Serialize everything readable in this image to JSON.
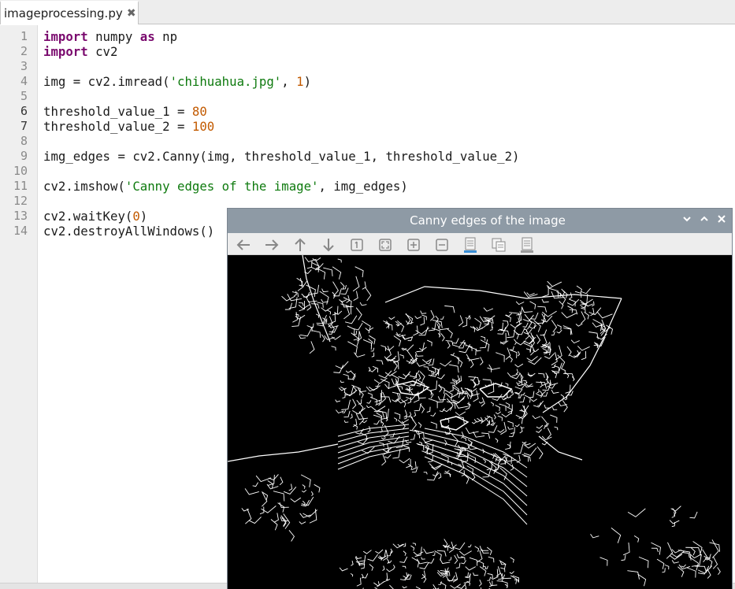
{
  "tab": {
    "filename": "imageprocessing.py",
    "close_glyph": "✖"
  },
  "editor": {
    "line_numbers": [
      "1",
      "2",
      "3",
      "4",
      "5",
      "6",
      "7",
      "8",
      "9",
      "10",
      "11",
      "12",
      "13",
      "14"
    ],
    "lines": [
      [
        {
          "t": "import",
          "c": "kw"
        },
        {
          "t": " numpy ",
          "c": ""
        },
        {
          "t": "as",
          "c": "kw"
        },
        {
          "t": " np",
          "c": ""
        }
      ],
      [
        {
          "t": "import",
          "c": "kw"
        },
        {
          "t": " cv2",
          "c": ""
        }
      ],
      [],
      [
        {
          "t": "img = cv2.imread(",
          "c": ""
        },
        {
          "t": "'chihuahua.jpg'",
          "c": "str"
        },
        {
          "t": ", ",
          "c": ""
        },
        {
          "t": "1",
          "c": "num"
        },
        {
          "t": ")",
          "c": ""
        }
      ],
      [],
      [
        {
          "t": "threshold_value_1 = ",
          "c": ""
        },
        {
          "t": "80",
          "c": "num"
        }
      ],
      [
        {
          "t": "threshold_value_2 = ",
          "c": ""
        },
        {
          "t": "100",
          "c": "num"
        }
      ],
      [],
      [
        {
          "t": "img_edges = cv2.Canny(img, threshold_value_1, threshold_value_2)",
          "c": ""
        }
      ],
      [],
      [
        {
          "t": "cv2.imshow(",
          "c": ""
        },
        {
          "t": "'Canny edges of the image'",
          "c": "str"
        },
        {
          "t": ", img_edges)",
          "c": ""
        }
      ],
      [],
      [
        {
          "t": "cv2.waitKey(",
          "c": ""
        },
        {
          "t": "0",
          "c": "num"
        },
        {
          "t": ")",
          "c": ""
        }
      ],
      [
        {
          "t": "cv2.destroyAllWindows()",
          "c": ""
        }
      ]
    ]
  },
  "cv_window": {
    "title": "Canny edges of the image",
    "toolbar_icons": [
      "arrow-left-icon",
      "arrow-right-icon",
      "arrow-up-icon",
      "arrow-down-icon",
      "zoom-original-icon",
      "zoom-fit-icon",
      "zoom-in-icon",
      "zoom-out-icon",
      "save-icon",
      "copy-icon",
      "properties-icon"
    ],
    "window_buttons": [
      "minimize-icon",
      "maximize-icon",
      "close-icon"
    ]
  },
  "colors": {
    "keyword": "#7a0a6e",
    "string": "#0e7a0e",
    "number": "#c25a00",
    "titlebar": "#8e9aa5"
  }
}
